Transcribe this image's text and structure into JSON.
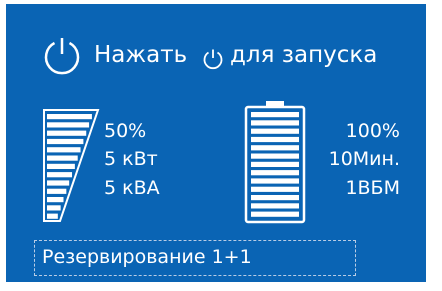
{
  "header": {
    "press_label": "Нажать",
    "start_label": "для запуска",
    "power_icon": "power-icon"
  },
  "load": {
    "icon": "load-bars-icon",
    "level_percent": 50,
    "percent_text": "50%",
    "kw_text": "5 кВт",
    "kva_text": "5 кВА"
  },
  "battery": {
    "icon": "battery-icon",
    "level_percent": 100,
    "percent_text": "100%",
    "runtime_text": "10Мин.",
    "modules_text": "1ВБМ"
  },
  "status": {
    "mode_text": "Резервирование 1+1"
  },
  "colors": {
    "panel": "#0a64b4",
    "foreground": "#ffffff",
    "dashed_border": "#b9cde6"
  }
}
